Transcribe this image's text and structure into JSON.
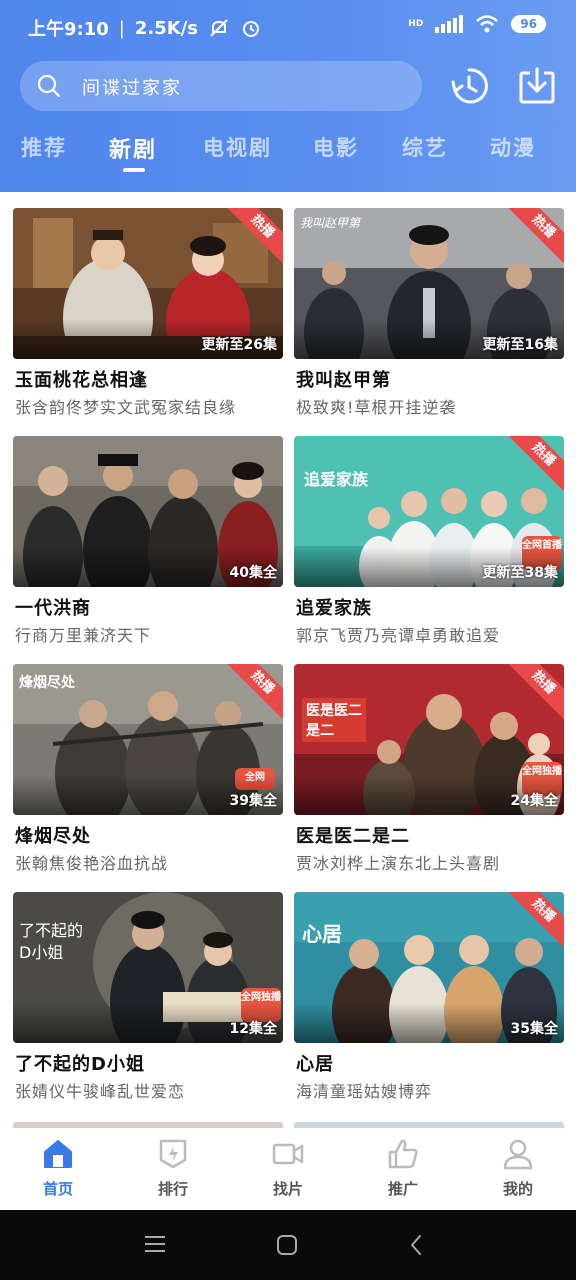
{
  "status_bar": {
    "time": "上午9:10",
    "net_speed": "2.5K/s",
    "battery": "96",
    "net_type": "HD"
  },
  "search": {
    "placeholder": "间谍过家家"
  },
  "header_icons": [
    "history-icon",
    "download-icon"
  ],
  "tabs": [
    {
      "label": "推荐",
      "active": false
    },
    {
      "label": "新剧",
      "active": true
    },
    {
      "label": "电视剧",
      "active": false
    },
    {
      "label": "电影",
      "active": false
    },
    {
      "label": "综艺",
      "active": false
    },
    {
      "label": "动漫",
      "active": false
    }
  ],
  "cards": [
    {
      "title": "玉面桃花总相逢",
      "subtitle": "张含韵佟梦实文武冤家结良缘",
      "episodes": "更新至26集",
      "hot": "热播"
    },
    {
      "title": "我叫赵甲第",
      "subtitle": "极致爽!草根开挂逆袭",
      "episodes": "更新至16集",
      "hot": "热播",
      "poster_text": "我叫赵甲第"
    },
    {
      "title": "一代洪商",
      "subtitle": "行商万里兼济天下",
      "episodes": "40集全"
    },
    {
      "title": "追爱家族",
      "subtitle": "郭京飞贾乃亮谭卓勇敢追爱",
      "episodes": "更新至38集",
      "hot": "热播",
      "poster_text": "追爱家族",
      "badge": "全网首播"
    },
    {
      "title": "烽烟尽处",
      "subtitle": "张翰焦俊艳浴血抗战",
      "episodes": "39集全",
      "hot": "热播",
      "poster_text": "烽烟尽处",
      "badge": "全网"
    },
    {
      "title": "医是医二是二",
      "subtitle": "贾冰刘桦上演东北上头喜剧",
      "episodes": "24集全",
      "hot": "热播",
      "poster_text": "医是医二是二",
      "badge": "全网独播"
    },
    {
      "title": "了不起的D小姐",
      "subtitle": "张婧仪牛骏峰乱世爱恋",
      "episodes": "12集全",
      "poster_text": "了不起的D小姐",
      "badge": "全网独播"
    },
    {
      "title": "心居",
      "subtitle": "海清童瑶姑嫂博弈",
      "episodes": "35集全",
      "hot": "热播",
      "poster_text": "心居"
    }
  ],
  "bottom_nav": [
    {
      "label": "首页",
      "icon": "home-icon",
      "active": true
    },
    {
      "label": "排行",
      "icon": "ranking-icon",
      "active": false
    },
    {
      "label": "找片",
      "icon": "video-camera-icon",
      "active": false
    },
    {
      "label": "推广",
      "icon": "thumbs-up-icon",
      "active": false
    },
    {
      "label": "我的",
      "icon": "user-icon",
      "active": false
    }
  ],
  "colors": {
    "header": "#5a8ff0",
    "accent": "#3a7ae8",
    "hot": "#e84a4a"
  }
}
